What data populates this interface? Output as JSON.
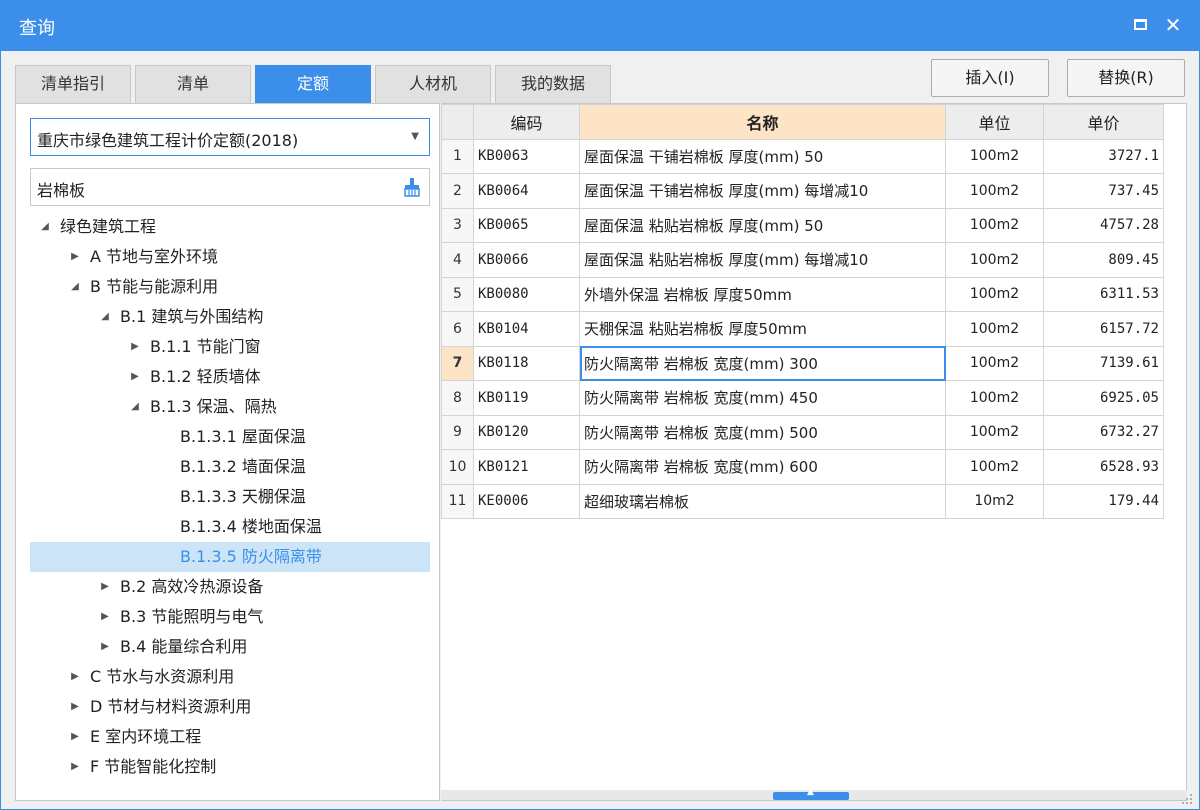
{
  "window": {
    "title": "查询"
  },
  "tabs": [
    {
      "label": "清单指引",
      "active": false
    },
    {
      "label": "清单",
      "active": false
    },
    {
      "label": "定额",
      "active": true
    },
    {
      "label": "人材机",
      "active": false
    },
    {
      "label": "我的数据",
      "active": false
    }
  ],
  "buttons": {
    "insert": "插入(I)",
    "replace": "替换(R)"
  },
  "quota_select": {
    "value": "重庆市绿色建筑工程计价定额(2018)"
  },
  "search": {
    "value": "岩棉板"
  },
  "tree": [
    {
      "label": "绿色建筑工程",
      "level": 0,
      "state": "expanded"
    },
    {
      "label": "A 节地与室外环境",
      "level": 1,
      "state": "collapsed"
    },
    {
      "label": "B 节能与能源利用",
      "level": 1,
      "state": "expanded"
    },
    {
      "label": "B.1 建筑与外围结构",
      "level": 2,
      "state": "expanded"
    },
    {
      "label": "B.1.1 节能门窗",
      "level": 3,
      "state": "collapsed"
    },
    {
      "label": "B.1.2 轻质墙体",
      "level": 3,
      "state": "collapsed"
    },
    {
      "label": "B.1.3 保温、隔热",
      "level": 3,
      "state": "expanded"
    },
    {
      "label": "B.1.3.1 屋面保温",
      "level": 4,
      "state": "leaf"
    },
    {
      "label": "B.1.3.2 墙面保温",
      "level": 4,
      "state": "leaf"
    },
    {
      "label": "B.1.3.3 天棚保温",
      "level": 4,
      "state": "leaf"
    },
    {
      "label": "B.1.3.4 楼地面保温",
      "level": 4,
      "state": "leaf"
    },
    {
      "label": "B.1.3.5 防火隔离带",
      "level": 4,
      "state": "leaf",
      "selected": true
    },
    {
      "label": "B.2 高效冷热源设备",
      "level": 2,
      "state": "collapsed"
    },
    {
      "label": "B.3 节能照明与电气",
      "level": 2,
      "state": "collapsed"
    },
    {
      "label": "B.4 能量综合利用",
      "level": 2,
      "state": "collapsed"
    },
    {
      "label": "C 节水与水资源利用",
      "level": 1,
      "state": "collapsed"
    },
    {
      "label": "D 节材与材料资源利用",
      "level": 1,
      "state": "collapsed"
    },
    {
      "label": "E 室内环境工程",
      "level": 1,
      "state": "collapsed"
    },
    {
      "label": "F 节能智能化控制",
      "level": 1,
      "state": "collapsed"
    }
  ],
  "table": {
    "headers": {
      "code": "编码",
      "name": "名称",
      "unit": "单位",
      "price": "单价"
    },
    "current_row": 7,
    "rows": [
      {
        "num": "1",
        "code": "KB0063",
        "name": "屋面保温 干铺岩棉板 厚度(mm) 50",
        "unit": "100m2",
        "price": "3727.1"
      },
      {
        "num": "2",
        "code": "KB0064",
        "name": "屋面保温 干铺岩棉板 厚度(mm) 每增减10",
        "unit": "100m2",
        "price": "737.45"
      },
      {
        "num": "3",
        "code": "KB0065",
        "name": "屋面保温 粘贴岩棉板 厚度(mm) 50",
        "unit": "100m2",
        "price": "4757.28"
      },
      {
        "num": "4",
        "code": "KB0066",
        "name": "屋面保温 粘贴岩棉板 厚度(mm) 每增减10",
        "unit": "100m2",
        "price": "809.45"
      },
      {
        "num": "5",
        "code": "KB0080",
        "name": "外墙外保温 岩棉板 厚度50mm",
        "unit": "100m2",
        "price": "6311.53"
      },
      {
        "num": "6",
        "code": "KB0104",
        "name": "天棚保温 粘贴岩棉板 厚度50mm",
        "unit": "100m2",
        "price": "6157.72"
      },
      {
        "num": "7",
        "code": "KB0118",
        "name": "防火隔离带 岩棉板 宽度(mm) 300",
        "unit": "100m2",
        "price": "7139.61"
      },
      {
        "num": "8",
        "code": "KB0119",
        "name": "防火隔离带 岩棉板 宽度(mm) 450",
        "unit": "100m2",
        "price": "6925.05"
      },
      {
        "num": "9",
        "code": "KB0120",
        "name": "防火隔离带 岩棉板 宽度(mm) 500",
        "unit": "100m2",
        "price": "6732.27"
      },
      {
        "num": "10",
        "code": "KB0121",
        "name": "防火隔离带 岩棉板 宽度(mm) 600",
        "unit": "100m2",
        "price": "6528.93"
      },
      {
        "num": "11",
        "code": "KE0006",
        "name": "超细玻璃岩棉板",
        "unit": "10m2",
        "price": "179.44"
      }
    ]
  },
  "colors": {
    "accent": "#3b8fea",
    "header_highlight": "#fde4c6",
    "selection": "#cce4f7"
  },
  "icons": {
    "maximize": "maximize-icon",
    "close": "close-icon",
    "clear": "brush-icon",
    "dropdown": "chevron-down-icon"
  }
}
